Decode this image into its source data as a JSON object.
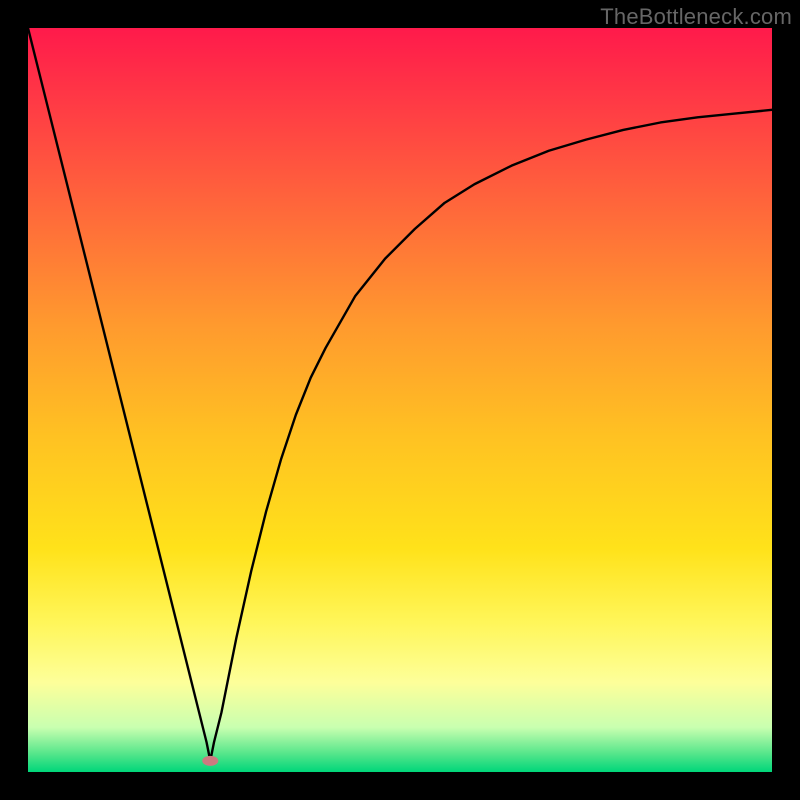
{
  "watermark": "TheBottleneck.com",
  "chart_data": {
    "type": "line",
    "title": "",
    "xlabel": "",
    "ylabel": "",
    "xlim": [
      0,
      100
    ],
    "ylim": [
      0,
      100
    ],
    "background_gradient": {
      "stops": [
        {
          "offset": 0.0,
          "color": "#ff1a4b"
        },
        {
          "offset": 0.1,
          "color": "#ff3a45"
        },
        {
          "offset": 0.25,
          "color": "#ff6a3a"
        },
        {
          "offset": 0.4,
          "color": "#ff9a2e"
        },
        {
          "offset": 0.55,
          "color": "#ffc222"
        },
        {
          "offset": 0.7,
          "color": "#ffe21a"
        },
        {
          "offset": 0.8,
          "color": "#fff65a"
        },
        {
          "offset": 0.88,
          "color": "#fdff9a"
        },
        {
          "offset": 0.94,
          "color": "#c9ffb0"
        },
        {
          "offset": 0.975,
          "color": "#57e68b"
        },
        {
          "offset": 1.0,
          "color": "#00d67a"
        }
      ]
    },
    "marker": {
      "x": 24.5,
      "y": 1.5,
      "color": "#cc7a80"
    },
    "series": [
      {
        "name": "curve",
        "x": [
          0,
          2,
          4,
          6,
          8,
          10,
          12,
          14,
          16,
          18,
          20,
          22,
          23,
          24,
          24.5,
          25,
          26,
          27,
          28,
          30,
          32,
          34,
          36,
          38,
          40,
          44,
          48,
          52,
          56,
          60,
          65,
          70,
          75,
          80,
          85,
          90,
          95,
          100
        ],
        "y": [
          100,
          92,
          84,
          76,
          68,
          60,
          52,
          44,
          36,
          28,
          20,
          12,
          8,
          4,
          1.5,
          4,
          8,
          13,
          18,
          27,
          35,
          42,
          48,
          53,
          57,
          64,
          69,
          73,
          76.5,
          79,
          81.5,
          83.5,
          85,
          86.3,
          87.3,
          88,
          88.5,
          89
        ]
      }
    ]
  }
}
